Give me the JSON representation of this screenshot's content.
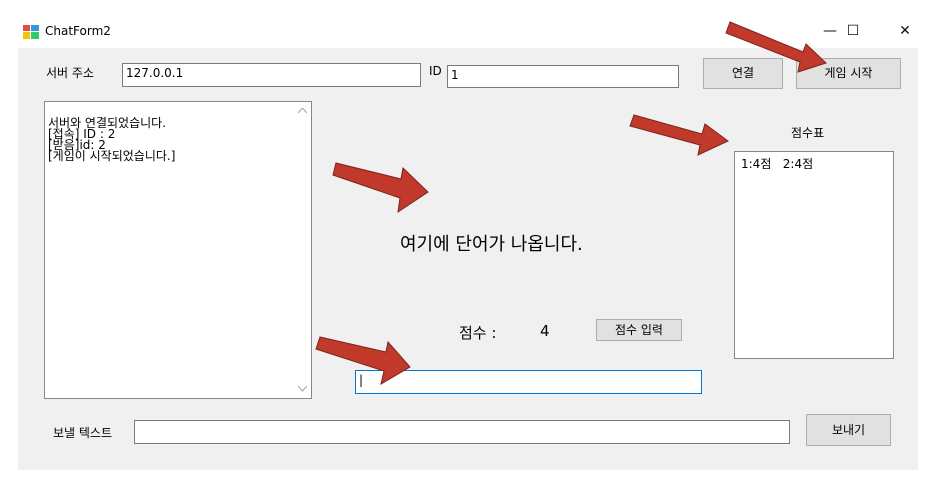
{
  "window": {
    "title": "ChatForm2"
  },
  "controls": {
    "minimize": "—",
    "maximize": "☐",
    "close": "✕"
  },
  "server": {
    "label": "서버 주소",
    "value": "127.0.0.1"
  },
  "id": {
    "label": "ID",
    "value": "1"
  },
  "buttons": {
    "connect": "연결",
    "start_game": "게임 시작",
    "submit_score": "점수 입력",
    "send": "보내기"
  },
  "log": {
    "lines": [
      "서버와 연결되었습니다.",
      "[접속] ID : 2",
      "[받음]id: 2",
      "[게임이 시작되었습니다.]"
    ]
  },
  "scoreboard": {
    "title": "점수표",
    "entries": "1:4점   2:4점"
  },
  "word": {
    "text": "여기에 단어가 나옵니다."
  },
  "score": {
    "label": "점수 :",
    "value": "4"
  },
  "answer_input": {
    "value": "|"
  },
  "send_text": {
    "label": "보낼 텍스트",
    "value": ""
  },
  "colors": {
    "arrow": "#c0392b",
    "focus_border": "#0078d7"
  }
}
